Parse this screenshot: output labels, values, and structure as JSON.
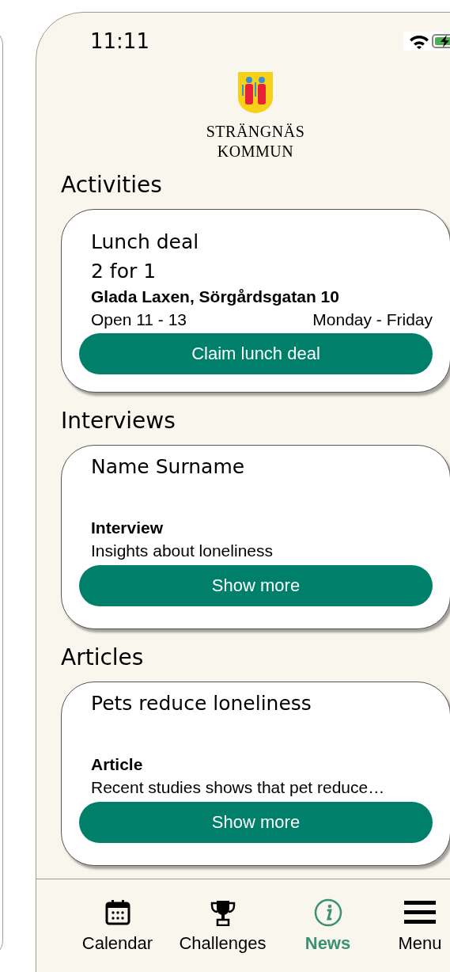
{
  "status_bar": {
    "time": "11:11"
  },
  "logo": {
    "lines": [
      "STRÄNGNÄS",
      "KOMMUN"
    ]
  },
  "sections": [
    {
      "title": "Activities",
      "card": {
        "kind": "deal",
        "title": "Lunch deal",
        "subtitle": "2 for 1",
        "place": "Glada Laxen, Sörgårdsgatan 10",
        "hours": "Open 11 - 13",
        "days": "Monday - Friday",
        "button": "Claim lunch deal"
      }
    },
    {
      "title": "Interviews",
      "card": {
        "kind": "story",
        "title": "Name Surname",
        "label": "Interview",
        "text": "Insights about loneliness",
        "button": "Show more"
      }
    },
    {
      "title": "Articles",
      "card": {
        "kind": "story",
        "title": "Pets reduce loneliness",
        "label": "Article",
        "text": "Recent studies shows that pet reduce…",
        "button": "Show more"
      }
    }
  ],
  "nav": [
    {
      "kind": "calendar",
      "label": "Calendar",
      "selected": false
    },
    {
      "kind": "trophy",
      "label": "Challenges",
      "selected": false
    },
    {
      "kind": "info",
      "label": "News",
      "selected": true
    },
    {
      "kind": "menu",
      "label": "Menu",
      "selected": false
    }
  ]
}
